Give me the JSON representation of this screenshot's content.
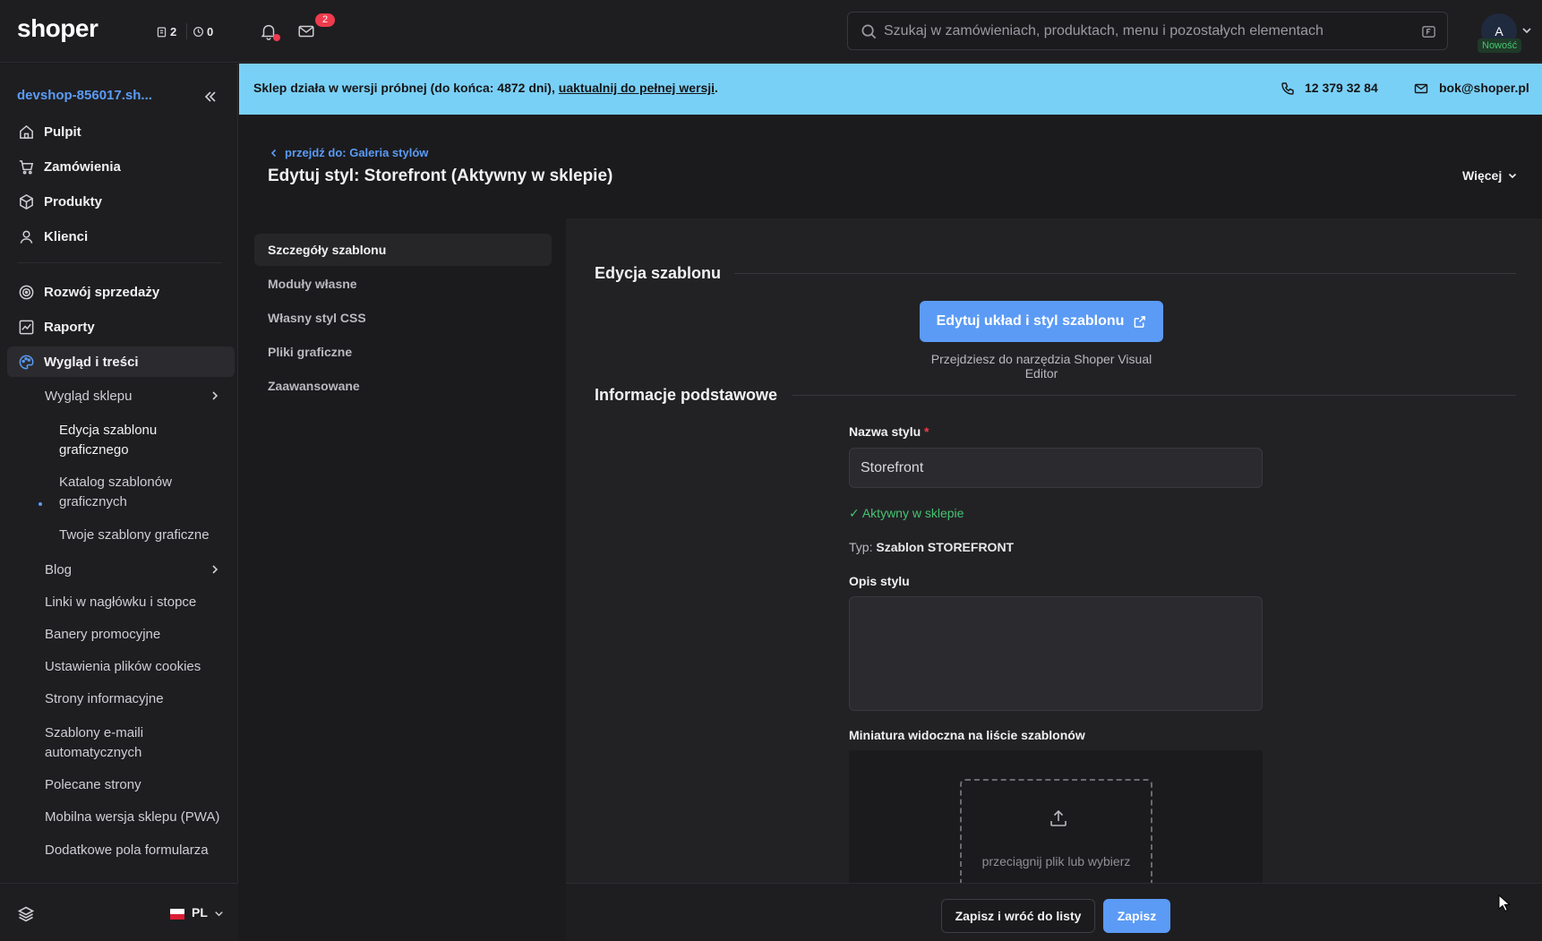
{
  "app": {
    "logo": "shoper",
    "counters": [
      {
        "icon": "clipboard-icon",
        "value": "2"
      },
      {
        "icon": "clock-icon",
        "value": "0"
      }
    ],
    "mail_badge": "2",
    "search_placeholder": "Szukaj w zamówieniach, produktach, menu i pozostałych elementach",
    "avatar_initial": "A",
    "new_badge": "Nowość"
  },
  "sidebar": {
    "shop_name": "devshop-856017.sh...",
    "items": [
      {
        "label": "Pulpit",
        "icon": "home-icon"
      },
      {
        "label": "Zamówienia",
        "icon": "cart-icon"
      },
      {
        "label": "Produkty",
        "icon": "box-icon"
      },
      {
        "label": "Klienci",
        "icon": "user-icon"
      },
      {
        "label": "Rozwój sprzedaży",
        "icon": "target-icon"
      },
      {
        "label": "Raporty",
        "icon": "chart-icon"
      },
      {
        "label": "Wygląd i treści",
        "icon": "palette-icon",
        "active": true
      }
    ],
    "sub_items": [
      {
        "label": "Wygląd sklepu",
        "has_chevron": true
      },
      {
        "label": "Edycja szablonu graficznego",
        "current": true
      },
      {
        "label": "Katalog szablonów graficznych"
      },
      {
        "label": "Twoje szablony graficzne"
      },
      {
        "label": "Blog",
        "has_chevron": true
      },
      {
        "label": "Linki w nagłówku i stopce"
      },
      {
        "label": "Banery promocyjne"
      },
      {
        "label": "Ustawienia plików cookies"
      },
      {
        "label": "Strony informacyjne"
      },
      {
        "label": "Szablony e-maili automatycznych"
      },
      {
        "label": "Polecane strony"
      },
      {
        "label": "Mobilna wersja sklepu (PWA)"
      },
      {
        "label": "Dodatkowe pola formularza"
      }
    ],
    "language": "PL"
  },
  "banner": {
    "text_before": "Sklep działa w wersji próbnej (do końca: 4872 dni), ",
    "link_text": "uaktualnij do pełnej wersji",
    "text_after": ".",
    "phone": "12 379 32 84",
    "email": "bok@shoper.pl",
    "background": "#79d0f6"
  },
  "page": {
    "back_link": "przejdź do: Galeria stylów",
    "title": "Edytuj styl: Storefront (Aktywny w sklepie)",
    "more_label": "Więcej"
  },
  "subnav": [
    {
      "label": "Szczegóły szablonu",
      "active": true
    },
    {
      "label": "Moduły własne"
    },
    {
      "label": "Własny styl CSS"
    },
    {
      "label": "Pliki graficzne"
    },
    {
      "label": "Zaawansowane"
    }
  ],
  "template_edit": {
    "section_title": "Edycja szablonu",
    "edit_button": "Edytuj układ i styl szablonu",
    "hint": "Przejdziesz do narzędzia Shoper Visual Editor"
  },
  "basic_info": {
    "section_title": "Informacje podstawowe",
    "name_label": "Nazwa stylu",
    "required_mark": "*",
    "name_value": "Storefront",
    "active_status": "✓ Aktywny w sklepie",
    "type_prefix": "Typ: ",
    "type_value": "Szablon STOREFRONT",
    "description_label": "Opis stylu",
    "description_value": "",
    "thumbnail_label": "Miniatura widoczna na liście szablonów",
    "dropzone_text": "przeciągnij plik lub wybierz"
  },
  "footer": {
    "save_back_label": "Zapisz i wróć do listy",
    "save_label": "Zapisz"
  },
  "colors": {
    "accent": "#5b9bf5",
    "success": "#45c471",
    "danger": "#ef3b4d"
  }
}
